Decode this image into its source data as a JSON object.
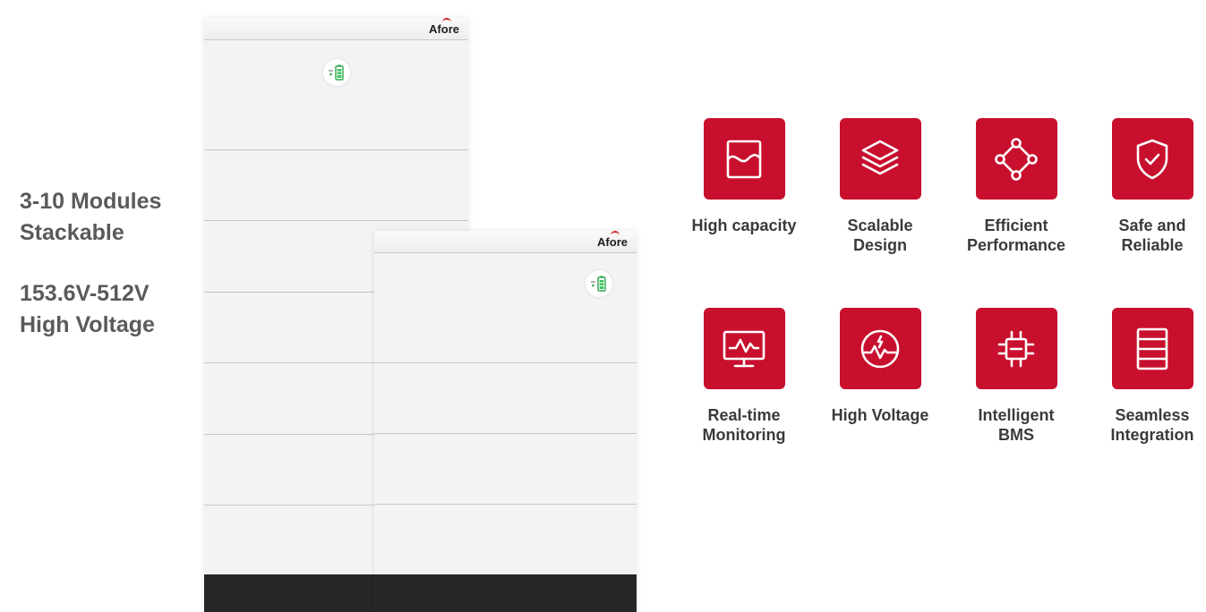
{
  "left_text": {
    "line1": "3-10 Modules",
    "line2": "Stackable",
    "line3": "153.6V-512V",
    "line4": "High Voltage"
  },
  "batteries": {
    "brand": "Afore"
  },
  "features": [
    {
      "label": "High capacity",
      "icon": "capacity-icon"
    },
    {
      "label": "Scalable\nDesign",
      "icon": "layers-icon"
    },
    {
      "label": "Efficient\nPerformance",
      "icon": "nodes-icon"
    },
    {
      "label": "Safe and\nReliable",
      "icon": "shield-check-icon"
    },
    {
      "label": "Real-time\nMonitoring",
      "icon": "monitor-icon"
    },
    {
      "label": "High Voltage",
      "icon": "voltage-icon"
    },
    {
      "label": "Intelligent\nBMS",
      "icon": "chip-icon"
    },
    {
      "label": "Seamless\nIntegration",
      "icon": "stack-icon"
    }
  ],
  "colors": {
    "accent": "#c8102e",
    "text_gray": "#5a5a5a",
    "base": "#262626"
  }
}
